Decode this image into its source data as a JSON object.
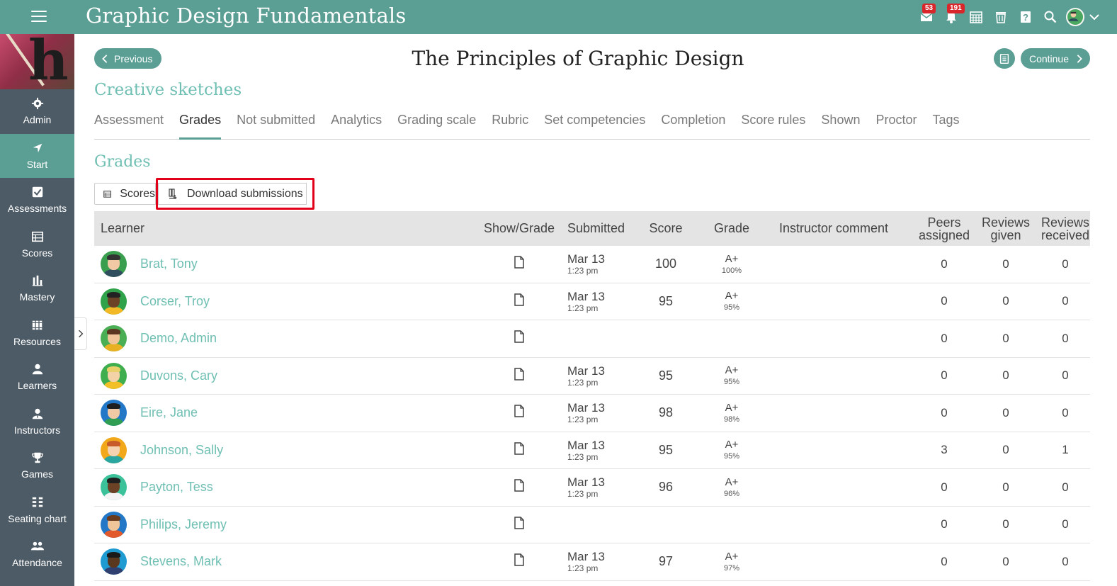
{
  "app": {
    "title": "Graphic Design Fundamentals"
  },
  "top_icons": [
    {
      "icon": "mail-icon",
      "badge": "53"
    },
    {
      "icon": "bell-icon",
      "badge": "191"
    },
    {
      "icon": "calendar-icon"
    },
    {
      "icon": "trash-icon"
    },
    {
      "icon": "help-icon"
    },
    {
      "icon": "search-icon"
    },
    {
      "icon": "user-avatar-icon"
    },
    {
      "icon": "chevron-down-icon"
    }
  ],
  "sidebar": {
    "items": [
      {
        "label": "Admin",
        "icon": "gear-icon"
      },
      {
        "label": "Start",
        "icon": "location-arrow-icon",
        "active": true
      },
      {
        "label": "Assessments",
        "icon": "checkbox-icon"
      },
      {
        "label": "Scores",
        "icon": "table-icon"
      },
      {
        "label": "Mastery",
        "icon": "bar-chart-icon"
      },
      {
        "label": "Resources",
        "icon": "books-icon"
      },
      {
        "label": "Learners",
        "icon": "person-icon"
      },
      {
        "label": "Instructors",
        "icon": "instructor-icon"
      },
      {
        "label": "Games",
        "icon": "trophy-icon"
      },
      {
        "label": "Seating chart",
        "icon": "seating-icon"
      },
      {
        "label": "Attendance",
        "icon": "people-icon"
      }
    ]
  },
  "nav": {
    "previous_label": "Previous",
    "continue_label": "Continue"
  },
  "page": {
    "title": "The Principles of Graphic Design",
    "section": "Creative sketches",
    "subheading": "Grades"
  },
  "tabs": [
    {
      "label": "Assessment"
    },
    {
      "label": "Grades",
      "active": true
    },
    {
      "label": "Not submitted"
    },
    {
      "label": "Analytics"
    },
    {
      "label": "Grading scale"
    },
    {
      "label": "Rubric"
    },
    {
      "label": "Set competencies"
    },
    {
      "label": "Completion"
    },
    {
      "label": "Score rules"
    },
    {
      "label": "Shown"
    },
    {
      "label": "Proctor"
    },
    {
      "label": "Tags"
    }
  ],
  "toolbar": {
    "scores_label": "Scores",
    "download_label": "Download submissions"
  },
  "table": {
    "headers": {
      "learner": "Learner",
      "show_grade": "Show/Grade",
      "submitted": "Submitted",
      "score": "Score",
      "grade": "Grade",
      "comment": "Instructor comment",
      "peers_1": "Peers",
      "peers_2": "assigned",
      "given_1": "Reviews",
      "given_2": "given",
      "received_1": "Reviews",
      "received_2": "received"
    },
    "rows": [
      {
        "name": "Brat, Tony",
        "date": "Mar 13",
        "time": "1:23 pm",
        "score": "100",
        "grade": "A+",
        "pct": "100%",
        "peers": "0",
        "given": "0",
        "received": "0",
        "avatar_bg": "#3a9e4f",
        "skin": "#f2c9a5",
        "shirt": "#2f4f5f",
        "hair": "#333333"
      },
      {
        "name": "Corser, Troy",
        "date": "Mar 13",
        "time": "1:23 pm",
        "score": "95",
        "grade": "A+",
        "pct": "95%",
        "peers": "0",
        "given": "0",
        "received": "0",
        "avatar_bg": "#2fa24a",
        "skin": "#6b4226",
        "shirt": "#f2b825",
        "hair": "#222222"
      },
      {
        "name": "Demo, Admin",
        "date": "",
        "time": "",
        "score": "",
        "grade": "",
        "pct": "",
        "peers": "0",
        "given": "0",
        "received": "0",
        "avatar_bg": "#4aae55",
        "skin": "#f1c59a",
        "shirt": "#e8b023",
        "hair": "#5a3520"
      },
      {
        "name": "Duvons, Cary",
        "date": "Mar 13",
        "time": "1:23 pm",
        "score": "95",
        "grade": "A+",
        "pct": "95%",
        "peers": "0",
        "given": "0",
        "received": "0",
        "avatar_bg": "#3fae4e",
        "skin": "#f4d2a8",
        "shirt": "#f2c026",
        "hair": "#e8d06a"
      },
      {
        "name": "Eire, Jane",
        "date": "Mar 13",
        "time": "1:23 pm",
        "score": "98",
        "grade": "A+",
        "pct": "98%",
        "peers": "0",
        "given": "0",
        "received": "0",
        "avatar_bg": "#2277c6",
        "skin": "#f2c9a5",
        "shirt": "#2f9e52",
        "hair": "#1f1f1f"
      },
      {
        "name": "Johnson, Sally",
        "date": "Mar 13",
        "time": "1:23 pm",
        "score": "95",
        "grade": "A+",
        "pct": "95%",
        "peers": "3",
        "given": "0",
        "received": "1",
        "avatar_bg": "#f2a81b",
        "skin": "#f5d2b0",
        "shirt": "#2aa6a0",
        "hair": "#c75c2a"
      },
      {
        "name": "Payton, Tess",
        "date": "Mar 13",
        "time": "1:23 pm",
        "score": "96",
        "grade": "A+",
        "pct": "96%",
        "peers": "0",
        "given": "0",
        "received": "0",
        "avatar_bg": "#3cc29a",
        "skin": "#6b4226",
        "shirt": "#f4f4f4",
        "hair": "#1f1f1f"
      },
      {
        "name": "Philips, Jeremy",
        "date": "",
        "time": "",
        "score": "",
        "grade": "",
        "pct": "",
        "peers": "0",
        "given": "0",
        "received": "0",
        "avatar_bg": "#2277c6",
        "skin": "#f1c59a",
        "shirt": "#e25a2b",
        "hair": "#6b3b1d"
      },
      {
        "name": "Stevens, Mark",
        "date": "Mar 13",
        "time": "1:23 pm",
        "score": "97",
        "grade": "A+",
        "pct": "97%",
        "peers": "0",
        "given": "0",
        "received": "0",
        "avatar_bg": "#1f9bd1",
        "skin": "#5a3820",
        "shirt": "#2f3f6f",
        "hair": "#1a1a1a"
      }
    ]
  },
  "colors": {
    "accent": "#5b9e94",
    "link": "#6fbfb3",
    "sidebar": "#4d5b66",
    "highlight": "#e3001b",
    "badge": "#d9262b"
  }
}
